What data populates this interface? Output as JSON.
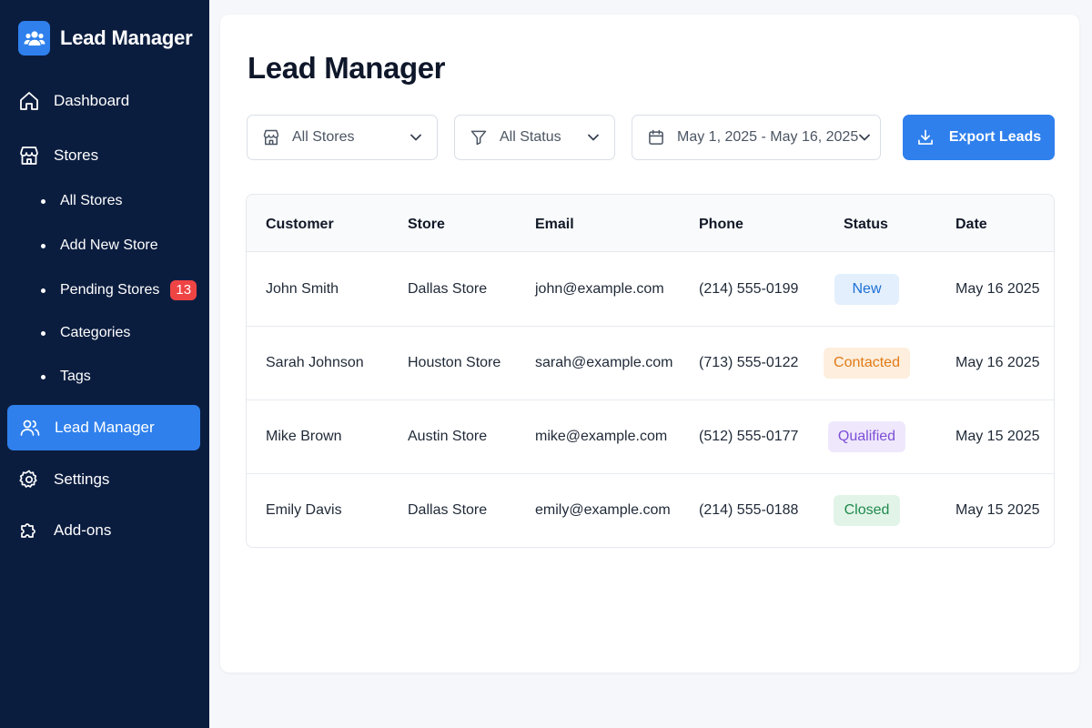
{
  "sidebar": {
    "brand": "Lead Manager",
    "items": [
      {
        "label": "Dashboard"
      },
      {
        "label": "Stores"
      }
    ],
    "stores_sub": [
      {
        "label": "All Stores"
      },
      {
        "label": "Add New Store"
      },
      {
        "label": "Pending Stores",
        "badge": "13"
      },
      {
        "label": "Categories"
      },
      {
        "label": "Tags"
      }
    ],
    "active": {
      "label": "Lead Manager"
    },
    "bottom": [
      {
        "label": "Settings"
      },
      {
        "label": "Add-ons"
      }
    ]
  },
  "main": {
    "title": "Lead Manager",
    "filters": {
      "store": "All Stores",
      "status": "All Status",
      "date_range": "May 1, 2025 - May 16, 2025"
    },
    "export_label": "Export Leads"
  },
  "table": {
    "headers": [
      "Customer",
      "Store",
      "Email",
      "Phone",
      "Status",
      "Date"
    ],
    "rows": [
      {
        "customer": "John Smith",
        "store": "Dallas Store",
        "email": "john@example.com",
        "phone": "(214) 555-0199",
        "status": "New",
        "date": "May 16 2025"
      },
      {
        "customer": "Sarah Johnson",
        "store": "Houston Store",
        "email": "sarah@example.com",
        "phone": "(713) 555-0122",
        "status": "Contacted",
        "date": "May 16 2025"
      },
      {
        "customer": "Mike Brown",
        "store": "Austin Store",
        "email": "mike@example.com",
        "phone": "(512) 555-0177",
        "status": "Qualified",
        "date": "May 15 2025"
      },
      {
        "customer": "Emily Davis",
        "store": "Dallas Store",
        "email": "emily@example.com",
        "phone": "(214) 555-0188",
        "status": "Closed",
        "date": "May 15 2025"
      }
    ]
  },
  "colors": {
    "sidebar_bg": "#0b1d3f",
    "accent": "#2f80ed",
    "badge": "#ef4444",
    "status_new": "#e3effc",
    "status_contacted": "#fdeedd",
    "status_qualified": "#efe8fc",
    "status_closed": "#e2f4e8"
  },
  "icons": {
    "brand": "users-icon",
    "dashboard": "home-icon",
    "stores": "store-icon",
    "lead_manager": "users-icon",
    "settings": "gear-icon",
    "addons": "puzzle-icon",
    "store_filter": "store-icon",
    "status_filter": "filter-icon",
    "date_filter": "calendar-icon",
    "export": "download-icon"
  }
}
